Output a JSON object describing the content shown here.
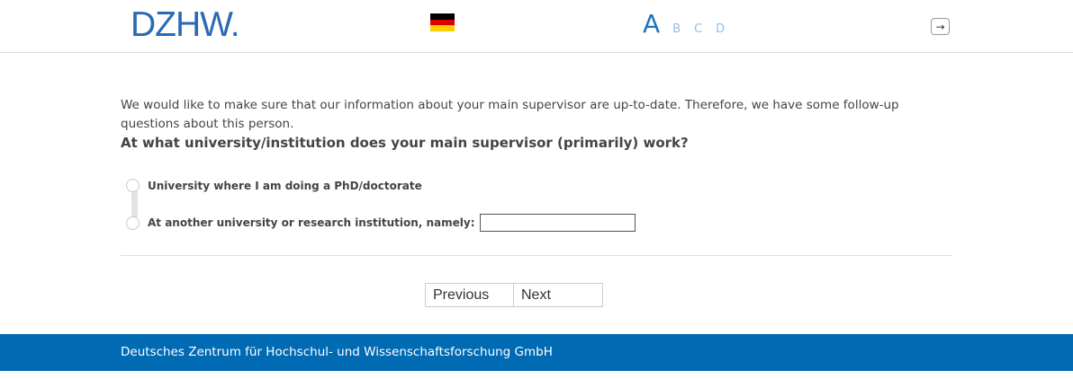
{
  "header": {
    "logo": "DZHW.",
    "flag_label": "German flag",
    "flag_colors": [
      "#000000",
      "#dd0000",
      "#ffce00"
    ],
    "steps": {
      "active": "A",
      "inactive": [
        "B",
        "C",
        "D"
      ]
    },
    "logout_icon": "logout-icon"
  },
  "main": {
    "intro": "We would like to make sure that our information about your main supervisor are up-to-date. Therefore, we have some follow-up questions about this person.",
    "question": "At what university/institution does your main supervisor (primarily) work?",
    "options": [
      {
        "label": "University where I am doing a PhD/doctorate"
      },
      {
        "label": "At another university or research institution, namely:",
        "input_value": ""
      }
    ]
  },
  "navigation": {
    "previous": "Previous",
    "next": "Next"
  },
  "footer": {
    "text": "Deutsches Zentrum für Hochschul- und Wissenschaftsforschung GmbH"
  },
  "colors": {
    "brand": "#006ab2",
    "logo": "#2a6ab2",
    "active_step": "#1a73c0",
    "inactive_step": "#8fbfe6"
  }
}
